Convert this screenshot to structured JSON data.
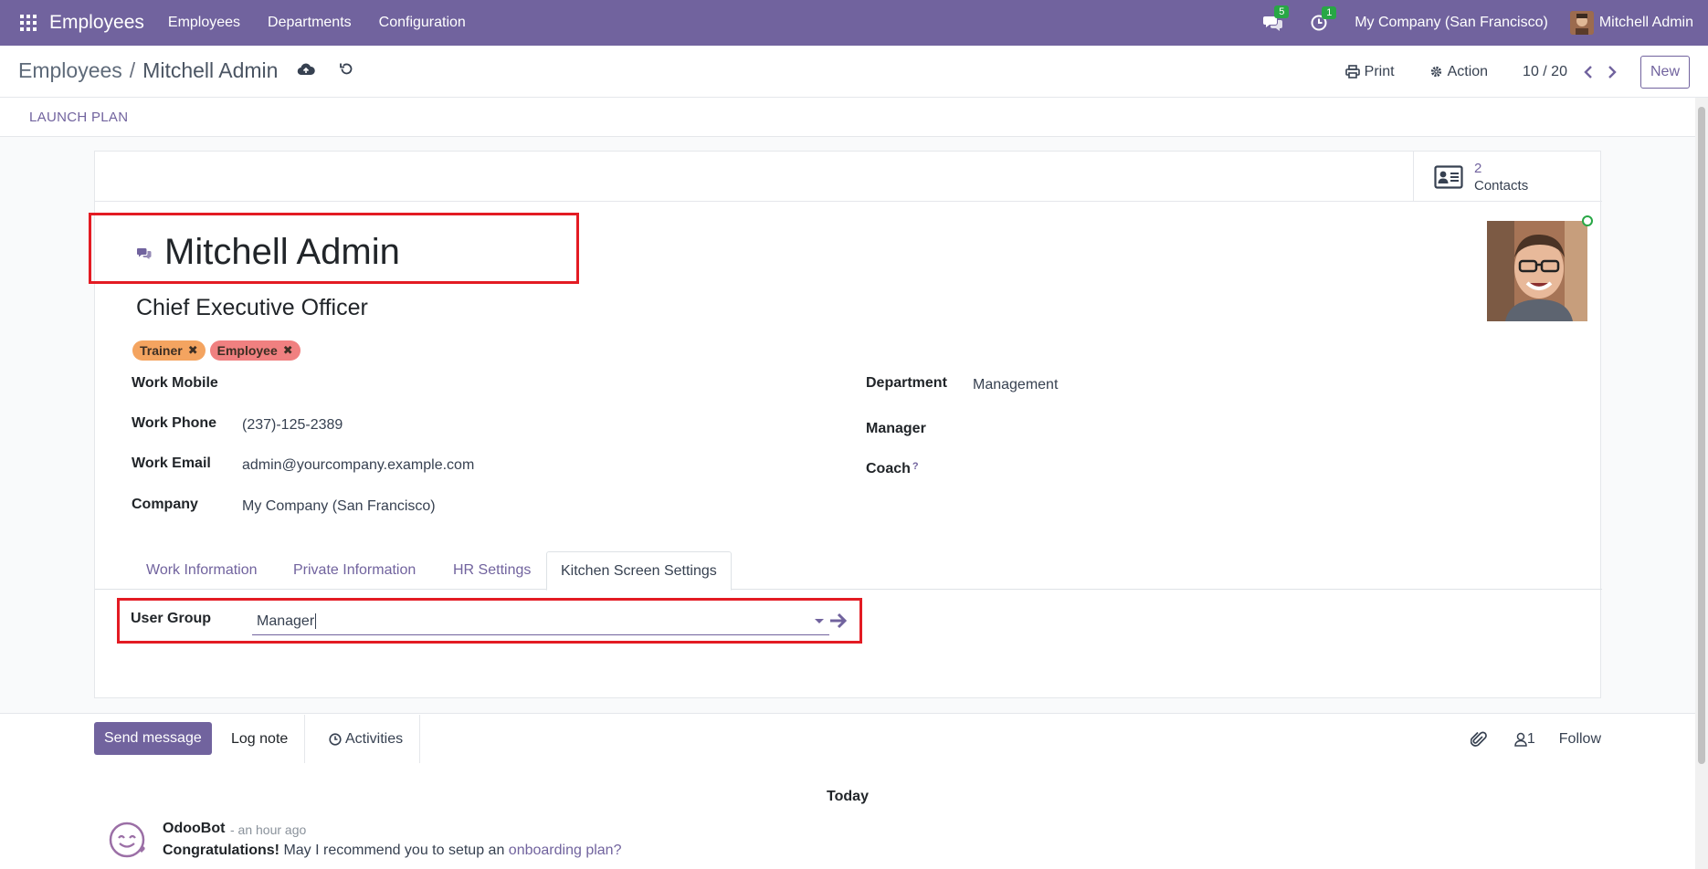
{
  "navbar": {
    "app_name": "Employees",
    "menu": [
      "Employees",
      "Departments",
      "Configuration"
    ],
    "messages_count": "5",
    "activities_count": "1",
    "company": "My Company (San Francisco)",
    "user": "Mitchell Admin"
  },
  "control_panel": {
    "breadcrumb_parent": "Employees",
    "breadcrumb_separator": "/",
    "breadcrumb_current": "Mitchell Admin",
    "print_label": "Print",
    "action_label": "Action",
    "pager": "10 / 20",
    "new_label": "New"
  },
  "statusbar": {
    "launch_plan_label": "LAUNCH PLAN"
  },
  "smart_button": {
    "count": "2",
    "label": "Contacts"
  },
  "employee": {
    "name": "Mitchell Admin",
    "job_title": "Chief Executive Officer",
    "tags": [
      {
        "label": "Trainer",
        "color": "#f4a460"
      },
      {
        "label": "Employee",
        "color": "#f08080"
      }
    ]
  },
  "fields_left": {
    "work_mobile_label": "Work Mobile",
    "work_mobile_value": "",
    "work_phone_label": "Work Phone",
    "work_phone_value": "(237)-125-2389",
    "work_email_label": "Work Email",
    "work_email_value": "admin@yourcompany.example.com",
    "company_label": "Company",
    "company_value": "My Company (San Francisco)"
  },
  "fields_right": {
    "department_label": "Department",
    "department_value": "Management",
    "manager_label": "Manager",
    "manager_value": "",
    "coach_label": "Coach",
    "coach_help": "?",
    "coach_value": ""
  },
  "tabs": [
    "Work Information",
    "Private Information",
    "HR Settings",
    "Kitchen Screen Settings"
  ],
  "active_tab": "Kitchen Screen Settings",
  "kitchen": {
    "user_group_label": "User Group",
    "user_group_value": "Manager"
  },
  "chatter": {
    "send_message_label": "Send message",
    "log_note_label": "Log note",
    "activities_label": "Activities",
    "followers_count": "1",
    "follow_label": "Follow",
    "date_separator": "Today",
    "message": {
      "author": "OdooBot",
      "time": "- an hour ago",
      "bold_text": "Congratulations!",
      "text": " May I recommend you to setup an ",
      "link_text": "onboarding plan?"
    }
  },
  "colors": {
    "brand": "#71639e",
    "highlight": "#e31b23",
    "online": "#28a745"
  }
}
